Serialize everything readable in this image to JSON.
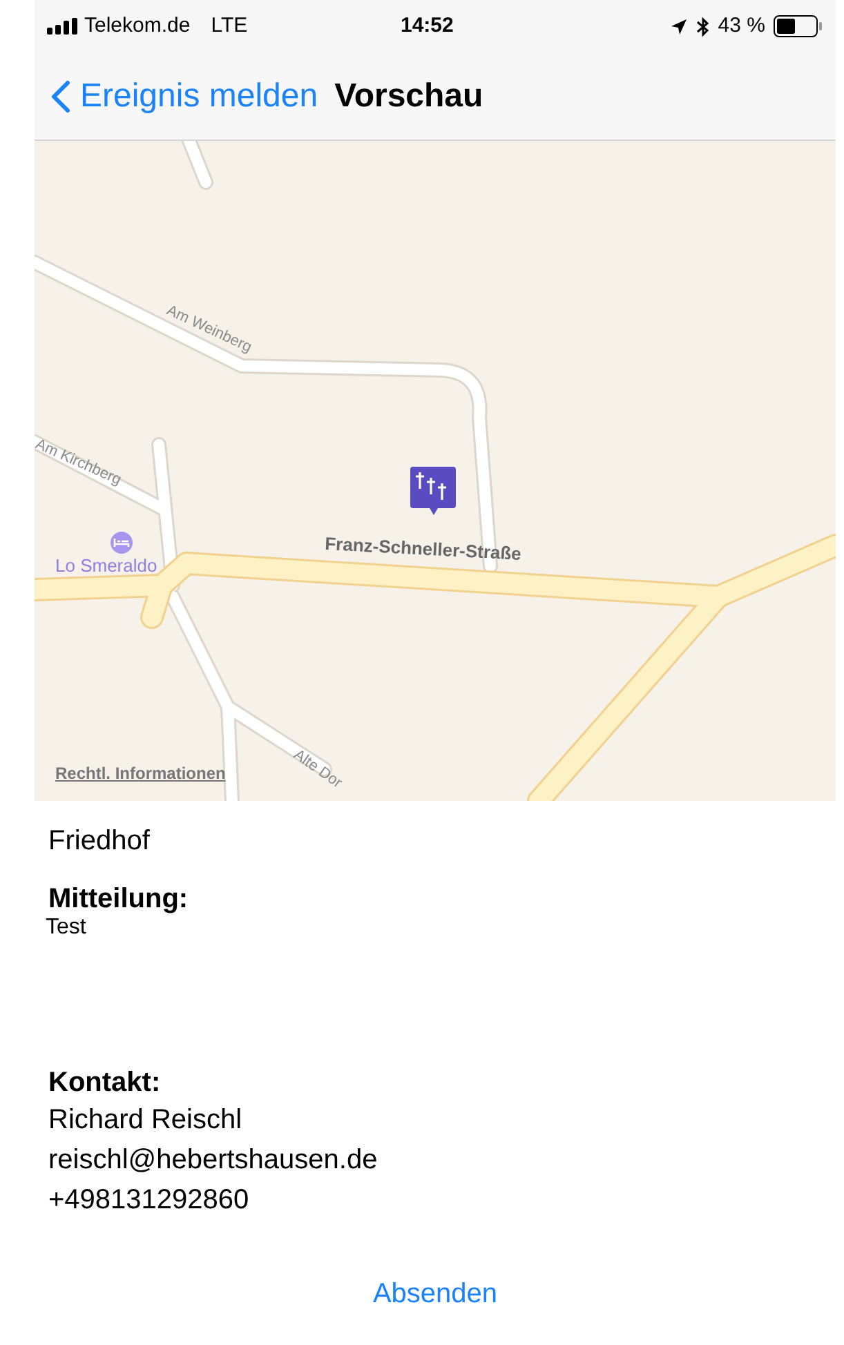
{
  "status_bar": {
    "carrier": "Telekom.de",
    "network": "LTE",
    "time": "14:52",
    "battery": "43 %"
  },
  "nav": {
    "back": "Ereignis melden",
    "title": "Vorschau"
  },
  "map": {
    "labels": [
      {
        "kind": "street",
        "text": "Am Weinberg"
      },
      {
        "kind": "street",
        "text": "Am Kirchberg"
      },
      {
        "kind": "poi",
        "text": "Lo Smeraldo"
      },
      {
        "kind": "major",
        "text": "Franz-Schneller-Straße"
      },
      {
        "kind": "street",
        "text": "Alte Dor"
      }
    ],
    "legal": "Rechtl. Informationen"
  },
  "category": "Friedhof",
  "message": {
    "label": "Mitteilung:",
    "text": "Test"
  },
  "contact": {
    "label": "Kontakt:",
    "lines": [
      "Richard Reischl",
      "reischl@hebertshausen.de",
      "+498131292860"
    ]
  },
  "button": "Absenden"
}
